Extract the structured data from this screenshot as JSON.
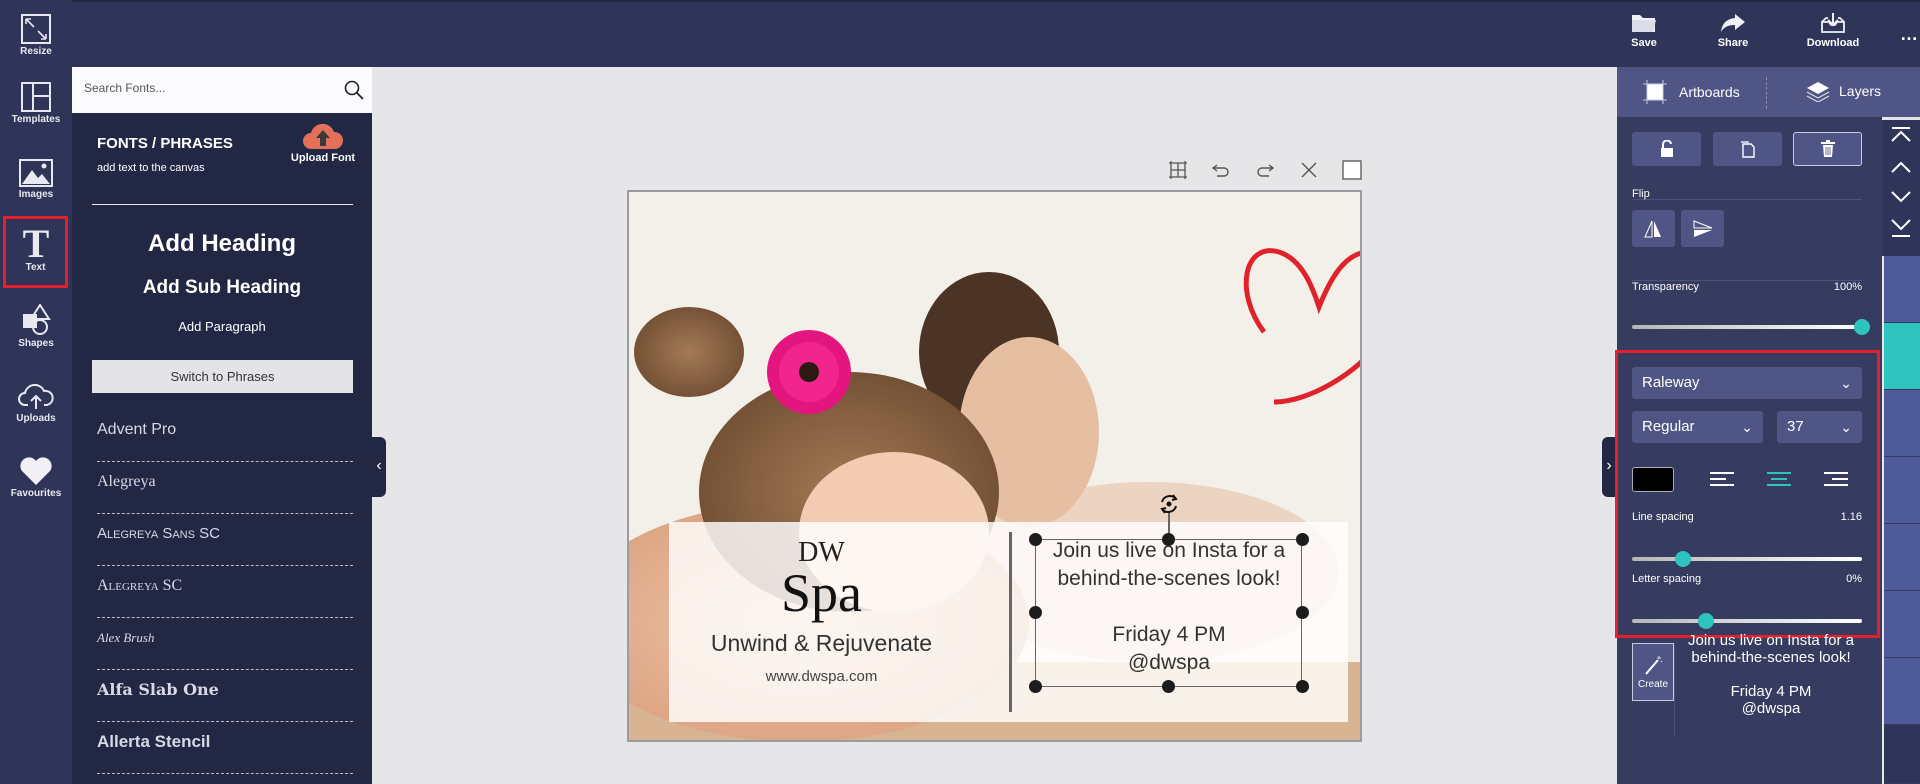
{
  "topbar": {
    "actions": [
      {
        "label": "Save",
        "icon": "folder-icon"
      },
      {
        "label": "Share",
        "icon": "share-arrow-icon"
      },
      {
        "label": "Download",
        "icon": "download-tray-icon"
      }
    ],
    "more": "…"
  },
  "rail": {
    "items": [
      {
        "label": "Resize",
        "icon": "resize-icon"
      },
      {
        "label": "Templates",
        "icon": "templates-icon"
      },
      {
        "label": "Images",
        "icon": "image-icon"
      },
      {
        "label": "Text",
        "icon": "text-icon",
        "active": true
      },
      {
        "label": "Shapes",
        "icon": "shapes-icon"
      },
      {
        "label": "Uploads",
        "icon": "upload-cloud-icon"
      },
      {
        "label": "Favourites",
        "icon": "heart-icon"
      }
    ]
  },
  "leftpanel": {
    "search_placeholder": "Search Fonts...",
    "title": "FONTS / PHRASES",
    "subtitle": "add text to the canvas",
    "upload_font": "Upload Font",
    "add_heading": "Add Heading",
    "add_subheading": "Add Sub Heading",
    "add_paragraph": "Add Paragraph",
    "switch_label": "Switch to Phrases",
    "fonts": [
      "Advent Pro",
      "Alegreya",
      "Alegreya Sans SC",
      "Alegreya SC",
      "Alex Brush",
      "Alfa Slab One",
      "Allerta Stencil"
    ]
  },
  "canvas": {
    "toolbar": [
      "grid-icon",
      "undo-icon",
      "redo-icon",
      "close-icon",
      "fullscreen-icon"
    ],
    "brand_top": "DW",
    "brand_main": "Spa",
    "tagline": "Unwind & Rejuvenate",
    "website": "www.dwspa.com",
    "selected_text_line1": "Join us live on Insta for a",
    "selected_text_line2": "behind-the-scenes look!",
    "selected_text_line3": "Friday 4 PM",
    "selected_text_line4": "@dwspa"
  },
  "rightpanel": {
    "tabs": {
      "artboards": "Artboards",
      "layers": "Layers"
    },
    "flip_label": "Flip",
    "transparency_label": "Transparency",
    "transparency_value": "100%",
    "transparency_fraction": 1.0,
    "font_family": "Raleway",
    "font_weight": "Regular",
    "font_size": "37",
    "text_color": "#000000",
    "alignment": "center",
    "line_spacing_label": "Line spacing",
    "line_spacing_value": "1.16",
    "line_spacing_fraction": 0.22,
    "letter_spacing_label": "Letter spacing",
    "letter_spacing_value": "0%",
    "letter_spacing_fraction": 0.32,
    "create_label": "Create",
    "preview_line1": "Join us live on Insta for a",
    "preview_line2": "behind-the-scenes look!",
    "preview_line3": "Friday 4 PM",
    "preview_line4": "@dwspa"
  },
  "colors": {
    "accent": "#2ec4bd",
    "highlight": "#e5202a",
    "topbar": "#2e3558",
    "panel": "#222744",
    "rightpanel": "#353c5f"
  }
}
